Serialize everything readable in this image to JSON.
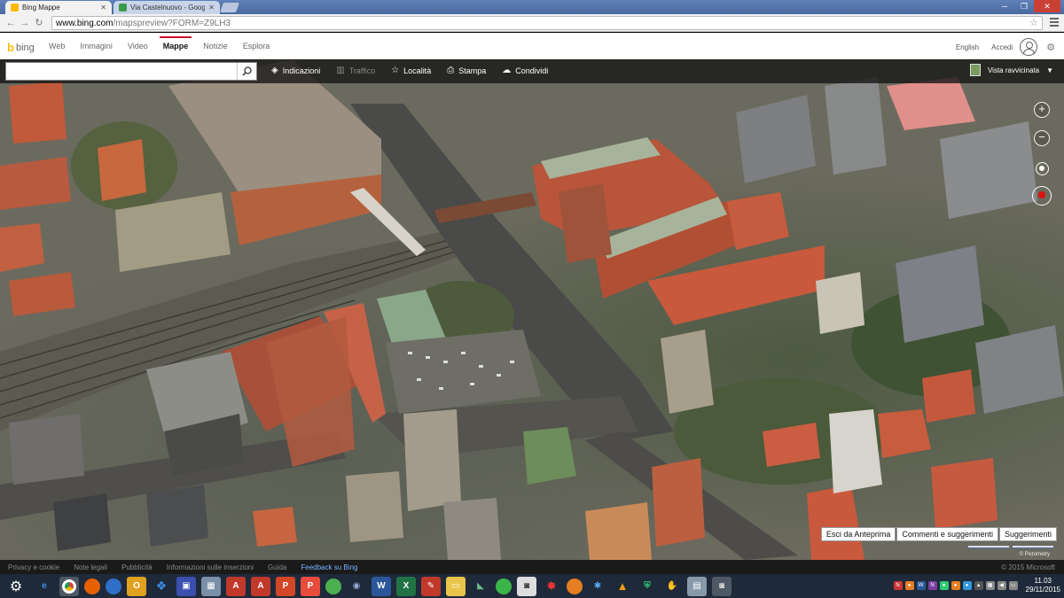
{
  "browser": {
    "tabs": [
      {
        "title": "Bing Mappe",
        "active": true
      },
      {
        "title": "Via Castelnuovo - Google",
        "active": false
      }
    ],
    "url_host": "www.bing.com",
    "url_path": "/mapspreview?FORM=Z9LH3"
  },
  "bing": {
    "logo": "bing",
    "nav": [
      "Web",
      "Immagini",
      "Video",
      "Mappe",
      "Notizie",
      "Esplora"
    ],
    "lang": "English",
    "signin": "Accedi"
  },
  "maptools": {
    "search_placeholder": "",
    "items": [
      {
        "label": "Indicazioni",
        "icon": "directions-icon",
        "glyph": "◈"
      },
      {
        "label": "Traffico",
        "icon": "traffic-icon",
        "glyph": "▥"
      },
      {
        "label": "Località",
        "icon": "star-icon",
        "glyph": "☆"
      },
      {
        "label": "Stampa",
        "icon": "printer-icon",
        "glyph": "⎙"
      },
      {
        "label": "Condividi",
        "icon": "share-icon",
        "glyph": "☁"
      }
    ],
    "view": "Vista ravvicinata"
  },
  "map": {
    "buttons": [
      "Esci da Anteprima",
      "Commenti e suggerimenti",
      "Suggerimenti"
    ],
    "imagery_credit": "© Pictometry"
  },
  "footer": {
    "links": [
      "Privacy e cookie",
      "Note legali",
      "Pubblicità",
      "Informazioni sulle inserzioni",
      "Guida"
    ],
    "feedback": "Feedback su Bing",
    "copyright": "© 2015 Microsoft"
  },
  "taskbar": {
    "time": "11.03",
    "date": "29/11/2015"
  },
  "colors": {
    "bing_accent": "#c8102e",
    "bing_logo": "#ffb900",
    "taskbar": "#1e2a3a",
    "roof_terracotta": "#b8553a"
  }
}
